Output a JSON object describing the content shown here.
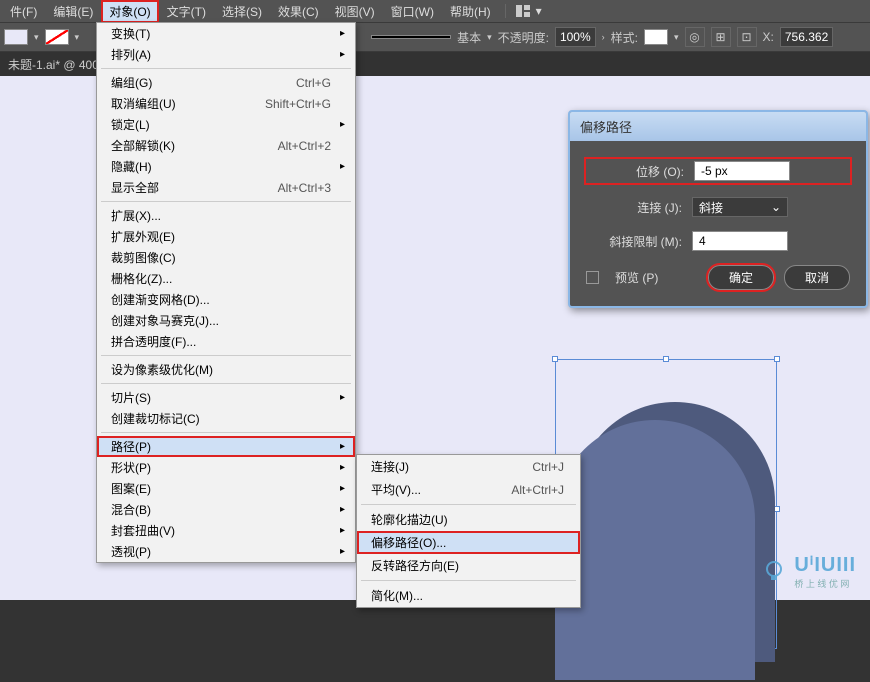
{
  "menubar": {
    "items": [
      {
        "label": "件(F)"
      },
      {
        "label": "编辑(E)"
      },
      {
        "label": "对象(O)",
        "active": true
      },
      {
        "label": "文字(T)"
      },
      {
        "label": "选择(S)"
      },
      {
        "label": "效果(C)"
      },
      {
        "label": "视图(V)"
      },
      {
        "label": "窗口(W)"
      },
      {
        "label": "帮助(H)"
      }
    ]
  },
  "optbar": {
    "basic": "基本",
    "opacity_label": "不透明度:",
    "opacity_value": "100%",
    "style_label": "样式:",
    "x_label": "X:",
    "x_value": "756.362"
  },
  "tabbar": {
    "title": "未题-1.ai* @ 400"
  },
  "object_menu": {
    "items": [
      {
        "label": "变换(T)",
        "arrow": true
      },
      {
        "label": "排列(A)",
        "arrow": true
      },
      {
        "sep": true
      },
      {
        "label": "编组(G)",
        "shortcut": "Ctrl+G"
      },
      {
        "label": "取消编组(U)",
        "shortcut": "Shift+Ctrl+G"
      },
      {
        "label": "锁定(L)",
        "arrow": true
      },
      {
        "label": "全部解锁(K)",
        "shortcut": "Alt+Ctrl+2"
      },
      {
        "label": "隐藏(H)",
        "arrow": true
      },
      {
        "label": "显示全部",
        "shortcut": "Alt+Ctrl+3"
      },
      {
        "sep": true
      },
      {
        "label": "扩展(X)..."
      },
      {
        "label": "扩展外观(E)"
      },
      {
        "label": "裁剪图像(C)"
      },
      {
        "label": "栅格化(Z)..."
      },
      {
        "label": "创建渐变网格(D)..."
      },
      {
        "label": "创建对象马赛克(J)..."
      },
      {
        "label": "拼合透明度(F)..."
      },
      {
        "sep": true
      },
      {
        "label": "设为像素级优化(M)"
      },
      {
        "sep": true
      },
      {
        "label": "切片(S)",
        "arrow": true
      },
      {
        "label": "创建裁切标记(C)"
      },
      {
        "sep": true
      },
      {
        "label": "路径(P)",
        "arrow": true,
        "highlight": true,
        "redbox": true
      },
      {
        "label": "形状(P)",
        "arrow": true
      },
      {
        "label": "图案(E)",
        "arrow": true
      },
      {
        "label": "混合(B)",
        "arrow": true
      },
      {
        "label": "封套扭曲(V)",
        "arrow": true
      },
      {
        "label": "透视(P)",
        "arrow": true
      }
    ]
  },
  "path_submenu": {
    "items": [
      {
        "label": "连接(J)",
        "shortcut": "Ctrl+J"
      },
      {
        "label": "平均(V)...",
        "shortcut": "Alt+Ctrl+J"
      },
      {
        "sep": true
      },
      {
        "label": "轮廓化描边(U)"
      },
      {
        "label": "偏移路径(O)...",
        "highlight": true
      },
      {
        "label": "反转路径方向(E)"
      },
      {
        "sep": true
      },
      {
        "label": "简化(M)..."
      }
    ]
  },
  "dialog": {
    "title": "偏移路径",
    "offset_label": "位移 (O):",
    "offset_value": "-5 px",
    "join_label": "连接 (J):",
    "join_value": "斜接",
    "limit_label": "斜接限制 (M):",
    "limit_value": "4",
    "preview": "预览 (P)",
    "ok": "确定",
    "cancel": "取消"
  },
  "watermark": {
    "brand": "UⁱIUIII",
    "sub": "桥  上  线  优  网"
  }
}
